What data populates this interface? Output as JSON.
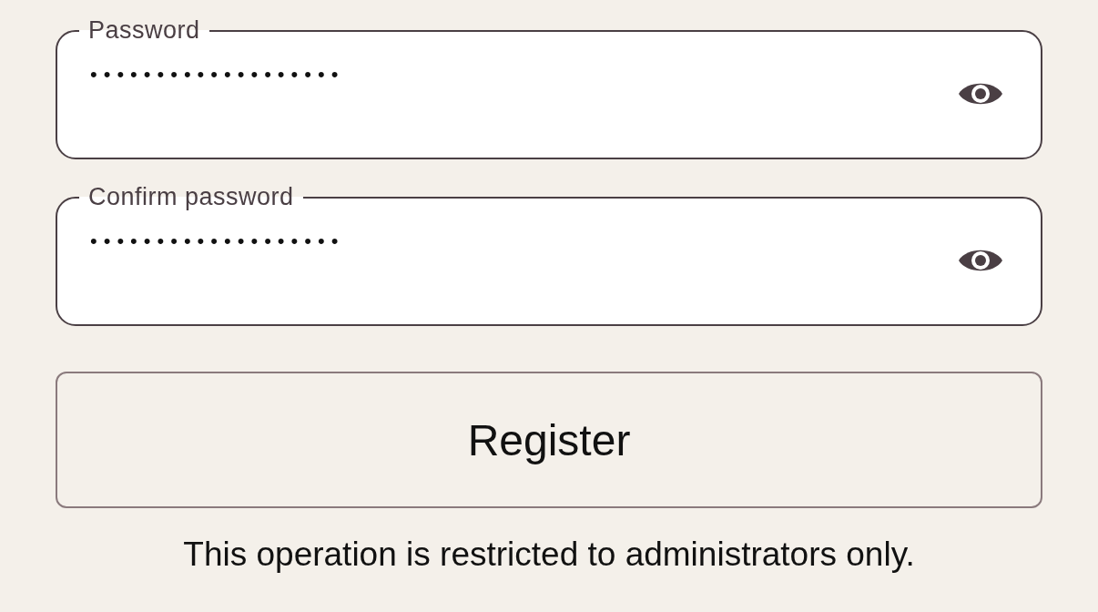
{
  "fields": [
    {
      "label": "Password",
      "value": "•••••••••••••••••••"
    },
    {
      "label": "Confirm password",
      "value": "•••••••••••••••••••"
    }
  ],
  "button": {
    "label": "Register"
  },
  "note": "This operation is restricted to administrators only."
}
